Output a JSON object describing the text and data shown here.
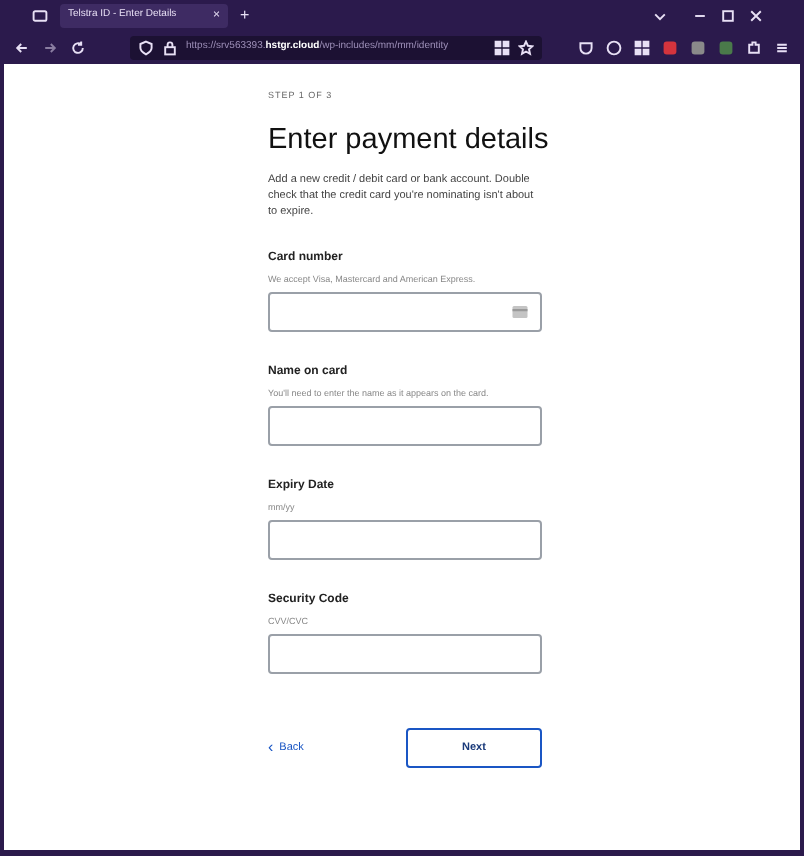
{
  "browser": {
    "tab_title": "Telstra ID - Enter Details",
    "close": "×",
    "new_tab": "+",
    "url_host": "https://srv563393.",
    "url_domain": "hstgr.cloud",
    "url_path": "/wp-includes/mm/mm/identity"
  },
  "step": "STEP 1 OF 3",
  "title": "Enter payment details",
  "description": "Add a new credit / debit card or bank account. Double check that the credit card you're nominating isn't about to expire.",
  "fields": [
    {
      "label": "Card number",
      "hint": "We accept Visa, Mastercard and American Express.",
      "kind": "card"
    },
    {
      "label": "Name on card",
      "hint": "You'll need to enter the name as it appears on the card.",
      "kind": "text"
    },
    {
      "label": "Expiry Date",
      "hint": "mm/yy",
      "kind": "text"
    },
    {
      "label": "Security Code",
      "hint": "CVV/CVC",
      "kind": "text"
    }
  ],
  "back": {
    "icon": "‹",
    "label": "Back"
  },
  "next": "Next"
}
